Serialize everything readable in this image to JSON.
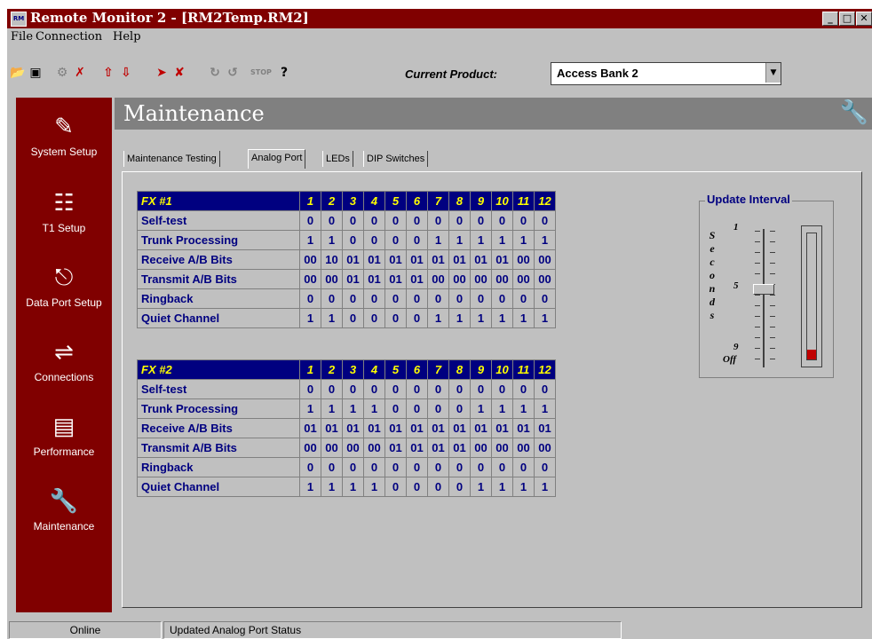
{
  "window": {
    "title": "Remote Monitor 2 - [RM2Temp.RM2]",
    "app_icon": "RM",
    "minimize": "_",
    "maximize": "□",
    "close": "✕"
  },
  "menu": [
    "File",
    "Connection",
    "Help"
  ],
  "toolbar": {
    "icons": [
      "open-icon",
      "save-icon",
      "connect-icon",
      "disconnect-icon",
      "upload-icon",
      "download-icon",
      "send-icon",
      "cancel-icon",
      "poll-icon",
      "poll-stop-icon",
      "stop-icon",
      "help-icon"
    ],
    "help_label": "?",
    "stop_label": "STOP",
    "current_product_label": "Current Product:",
    "current_product_value": "Access Bank 2"
  },
  "sidebar": [
    {
      "label": "System Setup",
      "icon": "notepad-icon"
    },
    {
      "label": "T1 Setup",
      "icon": "network-icon"
    },
    {
      "label": "Data Port Setup",
      "icon": "port-icon"
    },
    {
      "label": "Connections",
      "icon": "connections-icon"
    },
    {
      "label": "Performance",
      "icon": "performance-icon"
    },
    {
      "label": "Maintenance",
      "icon": "wrench-icon"
    }
  ],
  "header": {
    "title": "Maintenance",
    "icon": "wrench-icon"
  },
  "tabs": [
    "Maintenance Testing",
    "Analog Port",
    "LEDs",
    "DIP Switches"
  ],
  "active_tab": "Analog Port",
  "fx_tables": [
    {
      "title": "FX #1",
      "columns": [
        "1",
        "2",
        "3",
        "4",
        "5",
        "6",
        "7",
        "8",
        "9",
        "10",
        "11",
        "12"
      ],
      "rows": [
        {
          "label": "Self-test",
          "values": [
            "0",
            "0",
            "0",
            "0",
            "0",
            "0",
            "0",
            "0",
            "0",
            "0",
            "0",
            "0"
          ]
        },
        {
          "label": "Trunk Processing",
          "values": [
            "1",
            "1",
            "0",
            "0",
            "0",
            "0",
            "1",
            "1",
            "1",
            "1",
            "1",
            "1"
          ]
        },
        {
          "label": "Receive A/B Bits",
          "values": [
            "00",
            "10",
            "01",
            "01",
            "01",
            "01",
            "01",
            "01",
            "01",
            "01",
            "00",
            "00"
          ]
        },
        {
          "label": "Transmit A/B Bits",
          "values": [
            "00",
            "00",
            "01",
            "01",
            "01",
            "01",
            "00",
            "00",
            "00",
            "00",
            "00",
            "00"
          ]
        },
        {
          "label": "Ringback",
          "values": [
            "0",
            "0",
            "0",
            "0",
            "0",
            "0",
            "0",
            "0",
            "0",
            "0",
            "0",
            "0"
          ]
        },
        {
          "label": "Quiet Channel",
          "values": [
            "1",
            "1",
            "0",
            "0",
            "0",
            "0",
            "1",
            "1",
            "1",
            "1",
            "1",
            "1"
          ]
        }
      ]
    },
    {
      "title": "FX #2",
      "columns": [
        "1",
        "2",
        "3",
        "4",
        "5",
        "6",
        "7",
        "8",
        "9",
        "10",
        "11",
        "12"
      ],
      "rows": [
        {
          "label": "Self-test",
          "values": [
            "0",
            "0",
            "0",
            "0",
            "0",
            "0",
            "0",
            "0",
            "0",
            "0",
            "0",
            "0"
          ]
        },
        {
          "label": "Trunk Processing",
          "values": [
            "1",
            "1",
            "1",
            "1",
            "0",
            "0",
            "0",
            "0",
            "1",
            "1",
            "1",
            "1"
          ]
        },
        {
          "label": "Receive A/B Bits",
          "values": [
            "01",
            "01",
            "01",
            "01",
            "01",
            "01",
            "01",
            "01",
            "01",
            "01",
            "01",
            "01"
          ]
        },
        {
          "label": "Transmit A/B Bits",
          "values": [
            "00",
            "00",
            "00",
            "00",
            "01",
            "01",
            "01",
            "01",
            "00",
            "00",
            "00",
            "00"
          ]
        },
        {
          "label": "Ringback",
          "values": [
            "0",
            "0",
            "0",
            "0",
            "0",
            "0",
            "0",
            "0",
            "0",
            "0",
            "0",
            "0"
          ]
        },
        {
          "label": "Quiet Channel",
          "values": [
            "1",
            "1",
            "1",
            "1",
            "0",
            "0",
            "0",
            "0",
            "1",
            "1",
            "1",
            "1"
          ]
        }
      ]
    }
  ],
  "update_interval": {
    "title": "Update Interval",
    "vertical_label": [
      "S",
      "e",
      "c",
      "o",
      "n",
      "d",
      "s"
    ],
    "scale_labels": {
      "top": "1",
      "middle": "5",
      "bottom_a": "9",
      "bottom_b": "Off"
    },
    "slider_value_seconds": 5,
    "meter_level": 0.08
  },
  "status": {
    "connection": "Online",
    "message": "Updated Analog Port Status"
  },
  "colors": {
    "title_bar": "#800000",
    "sidebar": "#800000",
    "table_header": "#000080",
    "table_header_text": "#ffff00",
    "cell_text": "#000080",
    "meter_fill": "#c00000"
  }
}
